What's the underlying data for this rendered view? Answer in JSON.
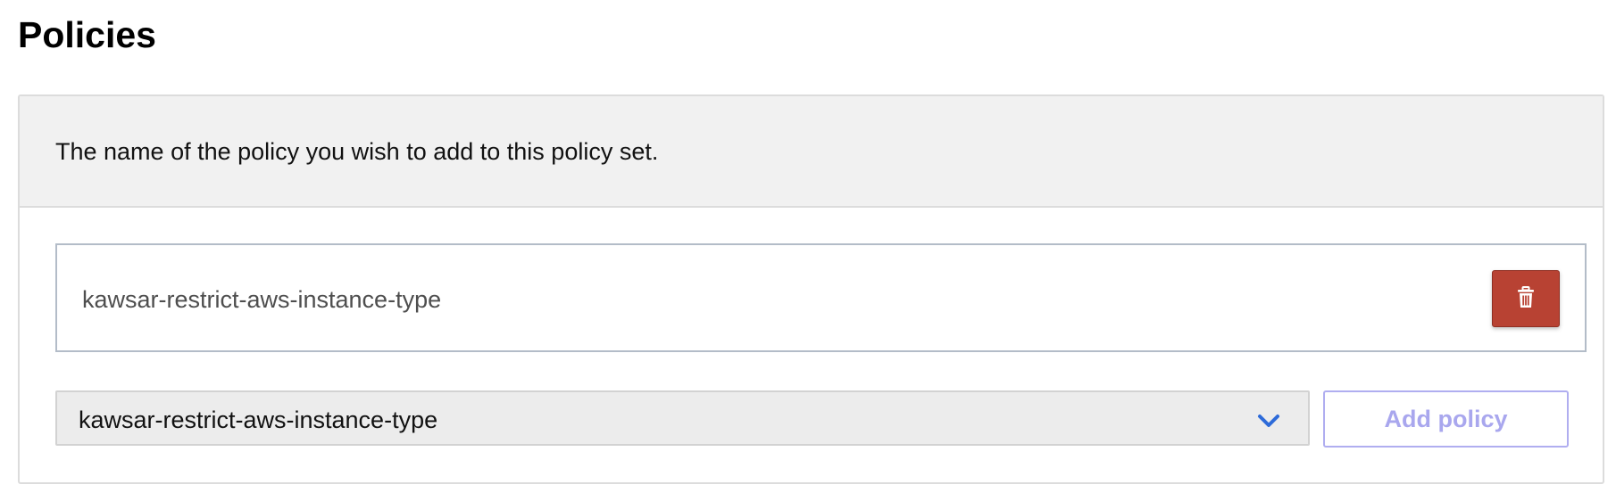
{
  "page": {
    "title": "Policies"
  },
  "panel": {
    "description": "The name of the policy you wish to add to this policy set."
  },
  "policy_list": {
    "items": [
      {
        "name": "kawsar-restrict-aws-instance-type",
        "delete_icon": "trash-icon"
      }
    ]
  },
  "policy_select": {
    "selected": "kawsar-restrict-aws-instance-type",
    "icon": "chevron-down-icon"
  },
  "add_button": {
    "label": "Add policy",
    "state": "disabled"
  },
  "colors": {
    "delete_button_bg": "#b84233",
    "chevron": "#2e6bd9",
    "add_button_text": "#a9a7ee",
    "panel_header_bg": "#f1f1f1"
  }
}
